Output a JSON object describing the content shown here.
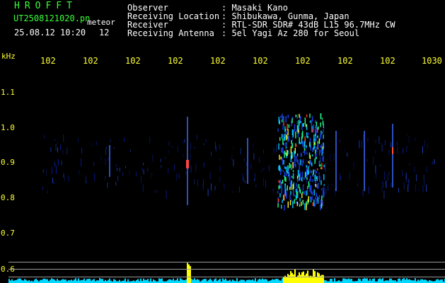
{
  "header": {
    "logo": "HROFFT",
    "filename": "UT2508121020.pn",
    "file_tag": "meteor",
    "timestamp": "25.08.12 10:20",
    "count": "12"
  },
  "meta": [
    {
      "label": "Observer",
      "value": ": Masaki Kano"
    },
    {
      "label": "Receiving Location",
      "value": ": Shibukawa, Gunma, Japan"
    },
    {
      "label": "Receiver",
      "value": ": RTL-SDR SDR# 43dB L15 96.7MHz CW"
    },
    {
      "label": "Receiving Antenna",
      "value": ": 5el Yagi Az 280 for Seoul"
    }
  ],
  "axis": {
    "unit": "kHz",
    "x_ticks": [
      "102",
      "102",
      "102",
      "102",
      "102",
      "102",
      "102",
      "102",
      "102",
      "1030"
    ],
    "y_ticks": [
      "1.1",
      "1.0",
      "0.9",
      "0.8",
      "0.7",
      "0.6"
    ]
  },
  "colors": {
    "bg": "#000000",
    "text_green": "#39ff39",
    "text_white": "#ffffff",
    "tick_yellow": "#ffff33",
    "signal_cyan": "#00e5ff",
    "signal_yellow": "#ffff00"
  }
}
